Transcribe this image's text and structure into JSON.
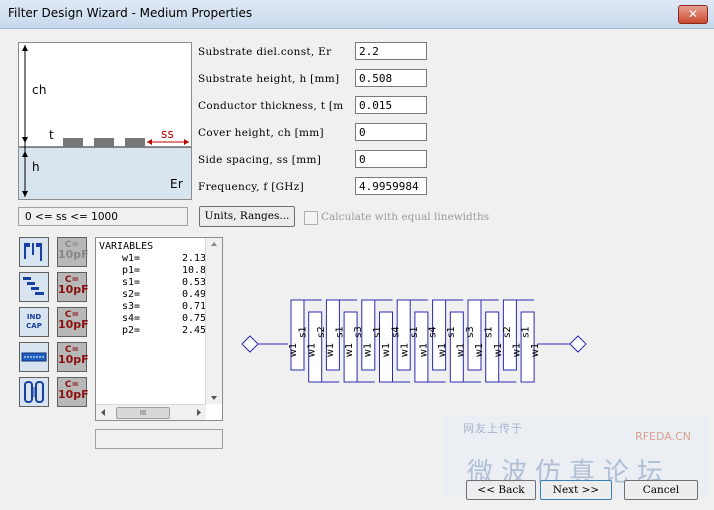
{
  "window": {
    "title": "Filter Design Wizard - Medium Properties",
    "close_label": "✕"
  },
  "diagram": {
    "ch": "ch",
    "t": "t",
    "ss": "ss",
    "h": "h",
    "er": "Er"
  },
  "fields": [
    {
      "label": "Substrate diel.const, Er",
      "value": "2.2"
    },
    {
      "label": "Substrate height, h [mm]",
      "value": "0.508"
    },
    {
      "label": "Conductor thickness, t [m",
      "value": "0.015"
    },
    {
      "label": "Cover height, ch [mm]",
      "value": "0"
    },
    {
      "label": "Side spacing, ss [mm]",
      "value": "0"
    },
    {
      "label": "Frequency, f [GHz]",
      "value": "4.9959984"
    }
  ],
  "range_text": "0 <= ss <= 1000",
  "units_button": "Units, Ranges...",
  "equal_lw_checkbox": {
    "label": "Calculate with equal linewidths",
    "checked": false
  },
  "tools": {
    "cap_label": "C=",
    "cap_value": "10pF",
    "ind_cap": "IND CAP"
  },
  "variables": {
    "title": "VARIABLES",
    "rows": [
      {
        "name": "w1=",
        "value": "2.13"
      },
      {
        "name": "p1=",
        "value": "10.8"
      },
      {
        "name": "s1=",
        "value": "0.53"
      },
      {
        "name": "s2=",
        "value": "0.49"
      },
      {
        "name": "s3=",
        "value": "0.71"
      },
      {
        "name": "s4=",
        "value": "0.75"
      },
      {
        "name": "p2=",
        "value": "2.45"
      }
    ],
    "hscroll_thumb": "III"
  },
  "layout_labels": [
    "w1",
    "s1",
    "w1",
    "s2",
    "w1",
    "s1",
    "w1",
    "s3",
    "w1",
    "s1",
    "w1",
    "s4",
    "w1",
    "s1",
    "w1",
    "s4",
    "w1",
    "s1",
    "w1",
    "s3",
    "w1",
    "s1",
    "w1",
    "s2",
    "w1",
    "s1",
    "w1"
  ],
  "nav": {
    "back": "<< Back",
    "next": "Next >>",
    "cancel": "Cancel"
  },
  "watermark": {
    "line1": "网友上传于",
    "line2": "RFEDA.CN",
    "line3": "微波仿真论坛"
  },
  "colors": {
    "layout_stroke": "#2b2bb0",
    "ss_arrow": "#c00000",
    "substrate": "#d8e4ee"
  }
}
